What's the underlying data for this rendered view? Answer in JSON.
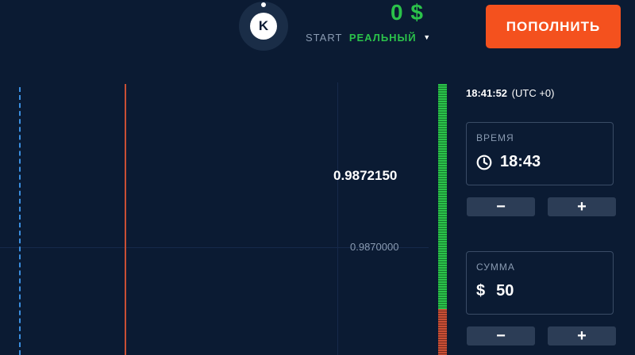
{
  "header": {
    "avatar_letter": "K",
    "balance": "0 $",
    "account_level": "START",
    "account_mode": "РЕАЛЬНЫЙ",
    "deposit_label": "ПОПОЛНИТЬ"
  },
  "chart": {
    "current_price": "0.9872150",
    "level_price": "0.9870000"
  },
  "panel": {
    "server_time": "18:41:52",
    "timezone": "(UTC +0)",
    "time_label": "ВРЕМЯ",
    "time_value": "18:43",
    "amount_label": "СУММА",
    "currency_symbol": "$",
    "amount_value": "50",
    "minus_label": "−",
    "plus_label": "+"
  },
  "colors": {
    "background": "#0b1b33",
    "accent_green": "#2bc24a",
    "deposit_orange": "#f4511e",
    "down_red": "#c94f35",
    "expiry_blue": "#3b8fe0"
  }
}
